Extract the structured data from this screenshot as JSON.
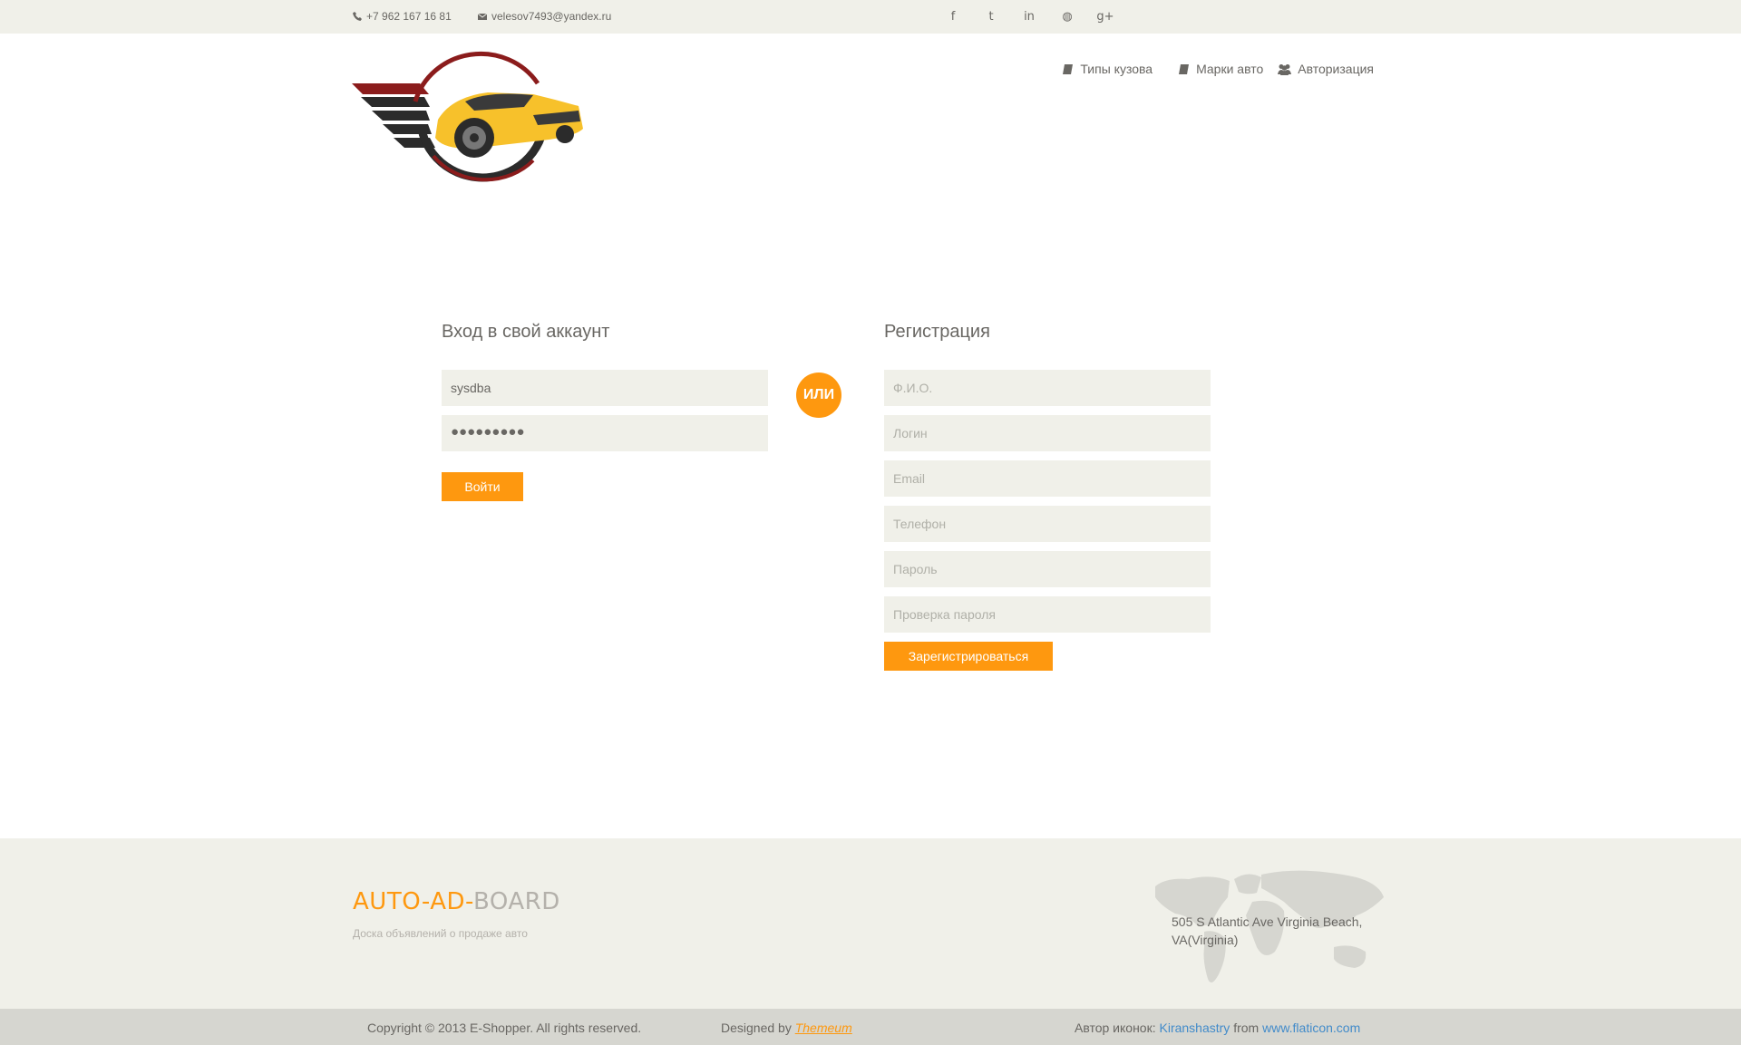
{
  "header": {
    "phone": "+7 962 167 16 81",
    "email": "velesov7493@yandex.ru",
    "social": [
      {
        "icon": "facebook-icon",
        "glyph": "f"
      },
      {
        "icon": "twitter-icon",
        "glyph": "t"
      },
      {
        "icon": "linkedin-icon",
        "glyph": "in"
      },
      {
        "icon": "dribbble-icon",
        "glyph": "◍"
      },
      {
        "icon": "google-plus-icon",
        "glyph": "g+"
      }
    ],
    "nav": {
      "body_types": "Типы кузова",
      "car_brands": "Марки авто",
      "auth": "Авторизация"
    }
  },
  "login": {
    "title": "Вход в свой аккаунт",
    "username": "sysdba",
    "password_mask": "●●●●●●●●●",
    "submit": "Войти"
  },
  "or_label": "ИЛИ",
  "register": {
    "title": "Регистрация",
    "fio_placeholder": "Ф.И.О.",
    "login_placeholder": "Логин",
    "email_placeholder": "Email",
    "phone_placeholder": "Телефон",
    "password_placeholder": "Пароль",
    "password_confirm_placeholder": "Проверка пароля",
    "submit": "Зарегистрироваться"
  },
  "footer": {
    "brand_part1": "AUTO-AD-",
    "brand_part2": "BOARD",
    "tagline": "Доска объявлений о продаже авто",
    "address": "505 S Atlantic Ave Virginia Beach, VA(Virginia)",
    "copyright": "Copyright © 2013 E-Shopper. All rights reserved.",
    "designed_by": "Designed by",
    "designer": "Themeum",
    "icons_author_label": "Автор иконок:",
    "icons_author": "Kiranshastry",
    "from_label": "from",
    "icons_site": "www.flaticon.com"
  },
  "colors": {
    "accent": "#fe980f",
    "panel": "#f0f0e9",
    "text": "#696763",
    "link": "#428bca"
  }
}
